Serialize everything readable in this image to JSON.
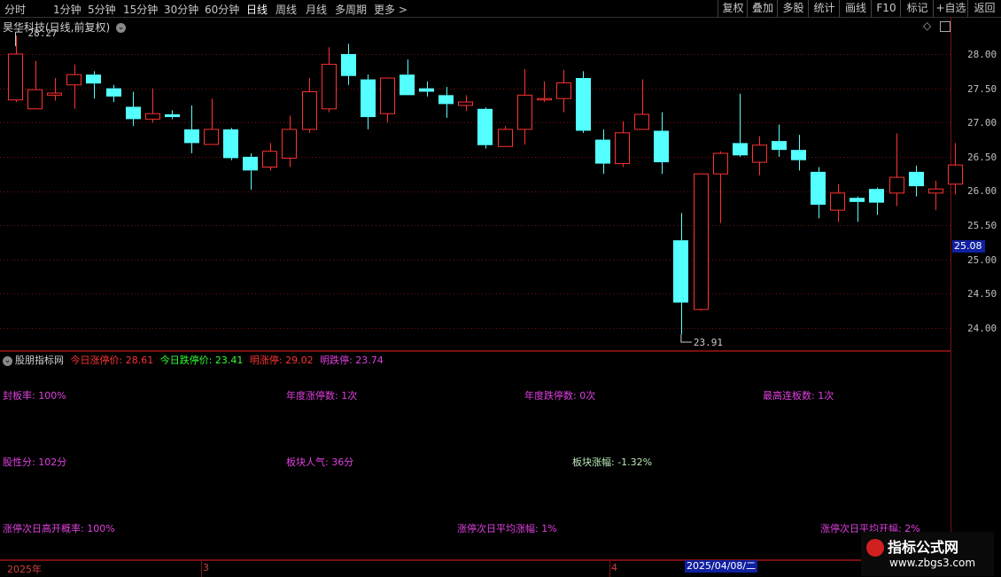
{
  "toolbar": {
    "periods": [
      "分时",
      "1分钟",
      "5分钟",
      "15分钟",
      "30分钟",
      "60分钟",
      "日线",
      "周线",
      "月线",
      "多周期",
      "更多 >"
    ],
    "active_period": "日线",
    "right_buttons": [
      "复权",
      "叠加",
      "多股",
      "统计",
      "画线",
      "F10",
      "标记",
      "+自选",
      "返回"
    ]
  },
  "chart": {
    "title": "昊华科技(日线,前复权)",
    "high_label": "28.27",
    "low_label": "23.91",
    "current_price": "25.08",
    "y_axis": [
      "28.00",
      "27.50",
      "27.00",
      "26.50",
      "26.00",
      "25.50",
      "25.00",
      "24.50",
      "24.00"
    ]
  },
  "indicator": {
    "name": "股朋指标网",
    "limit_up_label": "今日涨停价: 28.61",
    "limit_down_label": "今日跌停价: 23.41",
    "next_up_label": "明涨停: 29.02",
    "next_down_label": "明跌停: 23.74",
    "row1": [
      "封板率: 100%",
      "年度涨停数: 1次",
      "年度跌停数: 0次",
      "最高连板数: 1次"
    ],
    "row2": [
      "股性分: 102分",
      "板块人气: 36分",
      "板块涨幅: -1.32%"
    ],
    "row3": [
      "涨停次日高开概率: 100%",
      "涨停次日平均涨幅: 1%",
      "涨停次日平均开幅: 2%"
    ]
  },
  "date_axis": {
    "labels": [
      "2025年",
      "3",
      "4"
    ],
    "selected": "2025/04/08/二"
  },
  "watermark": {
    "main": "指标公式网",
    "sub": "www.zbgs3.com"
  },
  "chart_data": {
    "type": "candlestick",
    "title": "昊华科技(日线,前复权)",
    "ylim": [
      23.8,
      28.3
    ],
    "candles": [
      {
        "o": 27.33,
        "h": 28.27,
        "l": 27.3,
        "c": 28.0
      },
      {
        "o": 27.2,
        "h": 27.9,
        "l": 27.2,
        "c": 27.48
      },
      {
        "o": 27.4,
        "h": 27.65,
        "l": 27.32,
        "c": 27.43
      },
      {
        "o": 27.55,
        "h": 27.85,
        "l": 27.2,
        "c": 27.7
      },
      {
        "o": 27.7,
        "h": 27.75,
        "l": 27.35,
        "c": 27.57
      },
      {
        "o": 27.5,
        "h": 27.55,
        "l": 27.3,
        "c": 27.38
      },
      {
        "o": 27.23,
        "h": 27.45,
        "l": 26.95,
        "c": 27.05
      },
      {
        "o": 27.05,
        "h": 27.5,
        "l": 27.0,
        "c": 27.13
      },
      {
        "o": 27.12,
        "h": 27.18,
        "l": 27.05,
        "c": 27.08
      },
      {
        "o": 26.9,
        "h": 27.25,
        "l": 26.55,
        "c": 26.7
      },
      {
        "o": 26.68,
        "h": 27.35,
        "l": 26.68,
        "c": 26.9
      },
      {
        "o": 26.9,
        "h": 26.92,
        "l": 26.45,
        "c": 26.48
      },
      {
        "o": 26.5,
        "h": 26.55,
        "l": 26.02,
        "c": 26.3
      },
      {
        "o": 26.35,
        "h": 26.7,
        "l": 26.3,
        "c": 26.58
      },
      {
        "o": 26.48,
        "h": 27.1,
        "l": 26.35,
        "c": 26.9
      },
      {
        "o": 26.9,
        "h": 27.65,
        "l": 26.85,
        "c": 27.45
      },
      {
        "o": 27.2,
        "h": 28.1,
        "l": 27.15,
        "c": 27.85
      },
      {
        "o": 28.0,
        "h": 28.15,
        "l": 27.55,
        "c": 27.68
      },
      {
        "o": 27.63,
        "h": 27.7,
        "l": 26.9,
        "c": 27.08
      },
      {
        "o": 27.13,
        "h": 27.65,
        "l": 27.0,
        "c": 27.65
      },
      {
        "o": 27.7,
        "h": 27.92,
        "l": 27.4,
        "c": 27.4
      },
      {
        "o": 27.5,
        "h": 27.6,
        "l": 27.38,
        "c": 27.45
      },
      {
        "o": 27.4,
        "h": 27.52,
        "l": 27.07,
        "c": 27.27
      },
      {
        "o": 27.25,
        "h": 27.4,
        "l": 27.17,
        "c": 27.3
      },
      {
        "o": 27.2,
        "h": 27.22,
        "l": 26.62,
        "c": 26.67
      },
      {
        "o": 26.65,
        "h": 26.95,
        "l": 26.65,
        "c": 26.9
      },
      {
        "o": 26.9,
        "h": 27.78,
        "l": 26.68,
        "c": 27.4
      },
      {
        "o": 27.33,
        "h": 27.6,
        "l": 27.3,
        "c": 27.35
      },
      {
        "o": 27.35,
        "h": 27.77,
        "l": 27.15,
        "c": 27.58
      },
      {
        "o": 27.65,
        "h": 27.75,
        "l": 26.85,
        "c": 26.88
      },
      {
        "o": 26.75,
        "h": 26.9,
        "l": 26.25,
        "c": 26.4
      },
      {
        "o": 26.4,
        "h": 27.02,
        "l": 26.35,
        "c": 26.85
      },
      {
        "o": 26.9,
        "h": 27.63,
        "l": 26.9,
        "c": 27.12
      },
      {
        "o": 26.88,
        "h": 27.15,
        "l": 26.25,
        "c": 26.42
      },
      {
        "o": 25.28,
        "h": 25.68,
        "l": 23.91,
        "c": 24.37
      },
      {
        "o": 24.27,
        "h": 26.25,
        "l": 24.25,
        "c": 26.25
      },
      {
        "o": 26.25,
        "h": 26.58,
        "l": 25.53,
        "c": 26.55
      },
      {
        "o": 26.7,
        "h": 27.42,
        "l": 26.5,
        "c": 26.52
      },
      {
        "o": 26.42,
        "h": 26.8,
        "l": 26.23,
        "c": 26.67
      },
      {
        "o": 26.73,
        "h": 26.97,
        "l": 26.5,
        "c": 26.6
      },
      {
        "o": 26.6,
        "h": 26.82,
        "l": 26.3,
        "c": 26.45
      },
      {
        "o": 26.28,
        "h": 26.35,
        "l": 25.6,
        "c": 25.8
      },
      {
        "o": 25.72,
        "h": 26.1,
        "l": 25.55,
        "c": 25.97
      },
      {
        "o": 25.9,
        "h": 25.92,
        "l": 25.55,
        "c": 25.84
      },
      {
        "o": 26.03,
        "h": 26.05,
        "l": 25.65,
        "c": 25.83
      },
      {
        "o": 25.97,
        "h": 26.84,
        "l": 25.78,
        "c": 26.2
      },
      {
        "o": 26.28,
        "h": 26.37,
        "l": 25.92,
        "c": 26.07
      },
      {
        "o": 25.97,
        "h": 26.15,
        "l": 25.72,
        "c": 26.03
      },
      {
        "o": 26.1,
        "h": 26.7,
        "l": 25.95,
        "c": 26.38
      }
    ],
    "up_color": "#ff3232",
    "down_color": "#54ffff",
    "y_ticks": [
      28.0,
      27.5,
      27.0,
      26.5,
      26.0,
      25.5,
      25.0,
      24.5,
      24.0
    ],
    "grid": true
  },
  "colors": {
    "up": "#ff3232",
    "down": "#54ffff",
    "grid": "#7a1010",
    "label_red": "#ff3232",
    "label_green": "#30ff30",
    "label_magenta": "#e040e0"
  }
}
